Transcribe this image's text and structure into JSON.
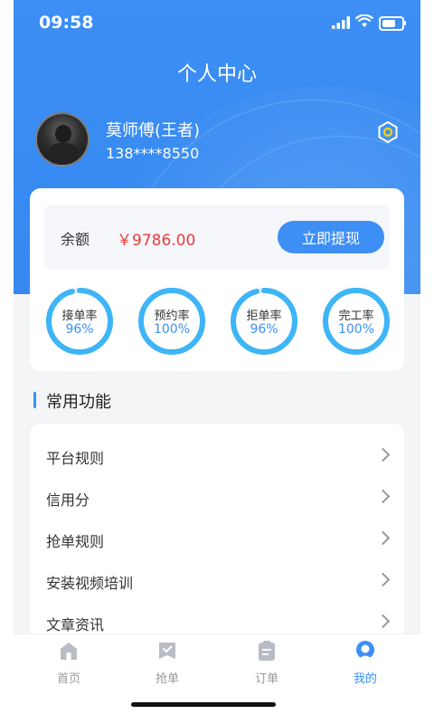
{
  "status_bar": {
    "time": "09:58"
  },
  "header": {
    "title": "个人中心"
  },
  "profile": {
    "name": "莫师傅(王者)",
    "phone": "138****8550"
  },
  "balance": {
    "label": "余额",
    "value": "￥9786.00",
    "withdraw_label": "立即提现"
  },
  "stats": [
    {
      "label": "接单率",
      "value": "96%",
      "fraction": 0.96
    },
    {
      "label": "预约率",
      "value": "100%",
      "fraction": 1.0
    },
    {
      "label": "拒单率",
      "value": "96%",
      "fraction": 0.96
    },
    {
      "label": "完工率",
      "value": "100%",
      "fraction": 1.0
    }
  ],
  "section": {
    "title": "常用功能"
  },
  "menu": [
    {
      "label": "平台规则"
    },
    {
      "label": "信用分"
    },
    {
      "label": "抢单规则"
    },
    {
      "label": "安装视频培训"
    },
    {
      "label": "文章资讯"
    }
  ],
  "tabs": [
    {
      "label": "首页",
      "icon": "home-icon"
    },
    {
      "label": "抢单",
      "icon": "grab-order-icon"
    },
    {
      "label": "订单",
      "icon": "order-icon"
    },
    {
      "label": "我的",
      "icon": "profile-icon",
      "active": true
    }
  ],
  "colors": {
    "primary": "#3d8ff5",
    "balance": "#f03a3a",
    "background": "#f4f5f7"
  }
}
